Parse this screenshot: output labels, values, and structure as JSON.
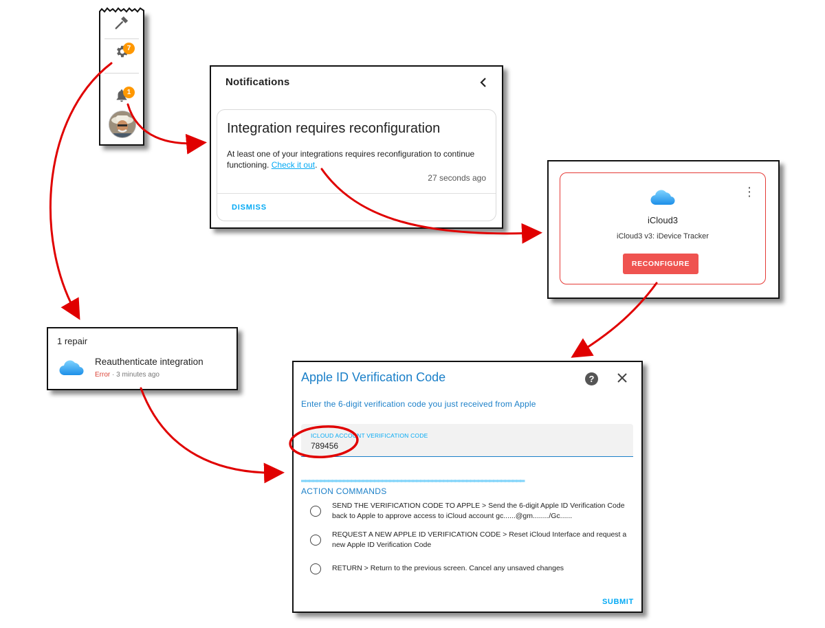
{
  "sidebar": {
    "settings_badge": "7",
    "notifications_badge": "1"
  },
  "notifications": {
    "title": "Notifications",
    "card": {
      "title": "Integration requires reconfiguration",
      "body": "At least one of your integrations requires reconfiguration to continue functioning.",
      "link": "Check it out",
      "link_suffix": ".",
      "time": "27 seconds ago",
      "dismiss": "DISMISS"
    }
  },
  "integration": {
    "name": "iCloud3",
    "subtitle": "iCloud3 v3: iDevice Tracker",
    "button": "RECONFIGURE"
  },
  "repairs": {
    "title": "1 repair",
    "item_name": "Reauthenticate integration",
    "status": "Error",
    "time": " · 3 minutes ago"
  },
  "dialog": {
    "title": "Apple ID Verification Code",
    "description": "Enter the 6-digit verification code you just received from Apple",
    "field_label": "ICLOUD ACCOUNT VERIFICATION CODE",
    "field_value": "789456",
    "separator": "══════════════════════════════════════════════════════════",
    "section_title": "ACTION COMMANDS",
    "options": [
      {
        "label": "SEND THE VERIFICATION CODE TO APPLE > Send the 6-digit Apple ID Verification Code back to Apple to approve access to iCloud account gc......@gm......../Gc......"
      },
      {
        "label": "REQUEST A NEW APPLE ID VERIFICATION CODE > Reset iCloud Interface and request a new Apple ID Verification Code"
      },
      {
        "label": "RETURN > Return to the previous screen. Cancel any unsaved changes"
      }
    ],
    "submit": "SUBMIT"
  },
  "colors": {
    "accent": "#03a9f4",
    "dialog_blue": "#1a7fc8",
    "badge": "#ff9800",
    "error": "#ef5350",
    "arrow": "#e00000"
  }
}
